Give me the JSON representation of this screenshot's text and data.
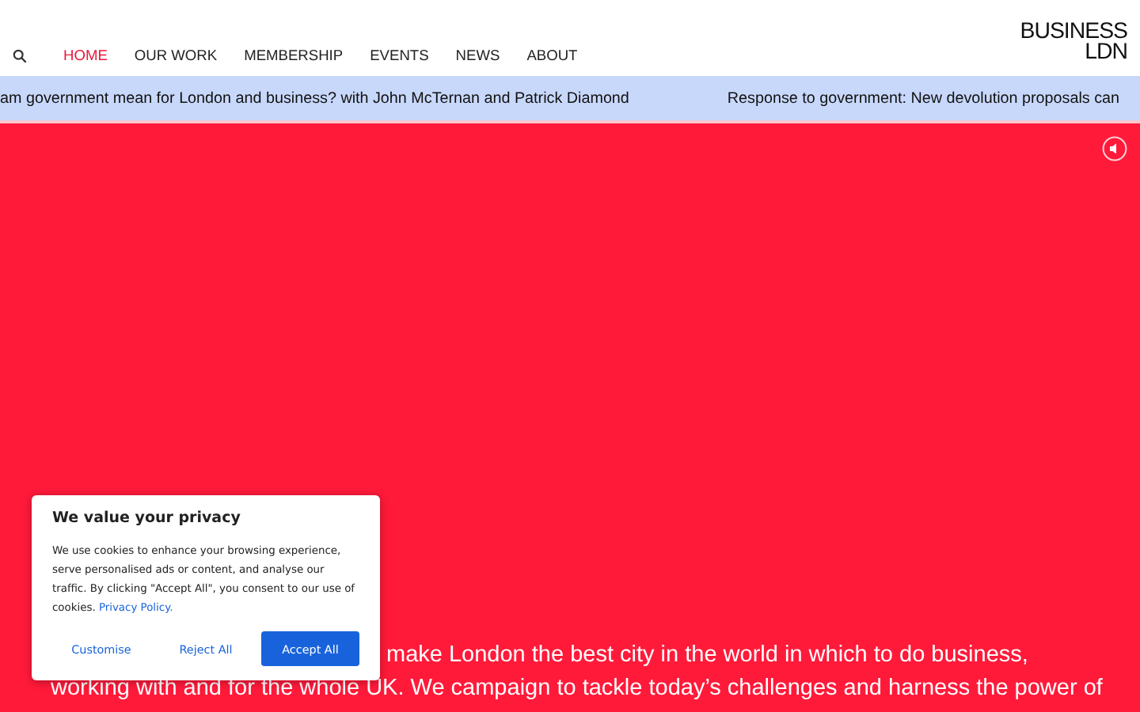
{
  "nav": {
    "items": [
      {
        "label": "HOME",
        "selected": true
      },
      {
        "label": "OUR WORK",
        "selected": false
      },
      {
        "label": "MEMBERSHIP",
        "selected": false
      },
      {
        "label": "EVENTS",
        "selected": false
      },
      {
        "label": "NEWS",
        "selected": false
      },
      {
        "label": "ABOUT",
        "selected": false
      }
    ],
    "logo": [
      "BUSINESS",
      "LDN"
    ]
  },
  "ticker": [
    "am government mean for London and business? with John McTernan and Patrick Diamond",
    "Response to government: New devolution proposals can"
  ],
  "hero": {
    "lines": [
      "make London the best city in the world in which to do business,",
      "working with and for the whole UK. We campaign to tackle today’s challenges and harness the power of"
    ]
  },
  "cookie_banner": {
    "title": "We value your privacy",
    "text": "We use cookies to enhance your browsing experience, serve personalised ads or content, and analyse our traffic. By clicking \"Accept All\", you consent to our use of cookies.",
    "link": "Privacy Policy.",
    "buttons": [
      {
        "label": "Customise",
        "kind": "text"
      },
      {
        "label": "Reject All",
        "kind": "text"
      },
      {
        "label": "Accept All",
        "kind": "primary"
      }
    ]
  }
}
